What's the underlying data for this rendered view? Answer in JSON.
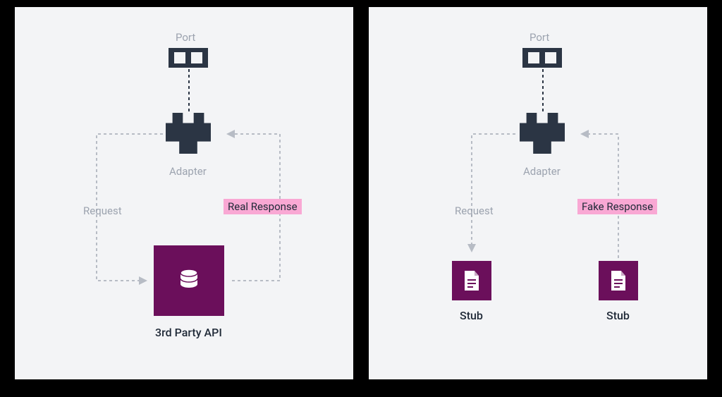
{
  "left": {
    "port_label": "Port",
    "adapter_label": "Adapter",
    "request_label": "Request",
    "response_label": "Real Response",
    "api_label": "3rd Party API"
  },
  "right": {
    "port_label": "Port",
    "adapter_label": "Adapter",
    "request_label": "Request",
    "response_label": "Fake Response",
    "stub_label_1": "Stub",
    "stub_label_2": "Stub"
  },
  "colors": {
    "panel_bg": "#f3f4f6",
    "shape_dark": "#2b3544",
    "box_purple": "#6b0f5b",
    "highlight_pink": "#f9a8d4",
    "text_muted": "#9ca3af",
    "text_dark": "#1f2937",
    "arrow": "#b7bcc5"
  }
}
